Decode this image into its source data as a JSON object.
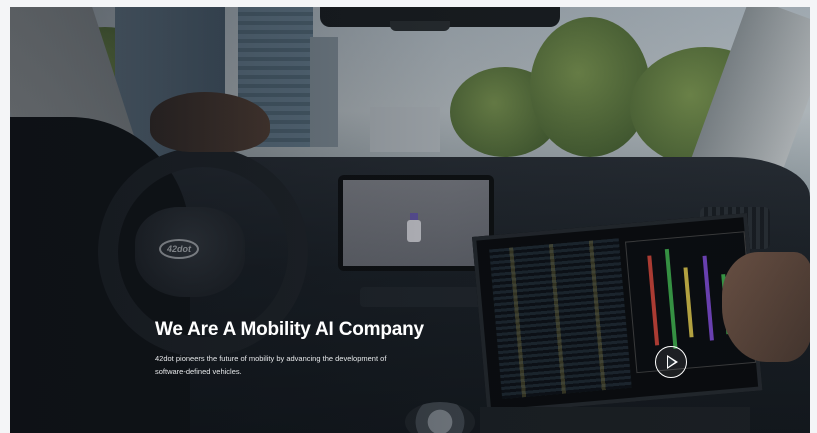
{
  "hero": {
    "title": "We Are A Mobility AI Company",
    "description": "42dot pioneers the future of mobility by advancing the development of software-defined vehicles.",
    "wheel_badge": "42dot",
    "play_icon": "play-icon"
  },
  "colors": {
    "title_text": "#ffffff",
    "page_background": "#f4f5f7"
  }
}
